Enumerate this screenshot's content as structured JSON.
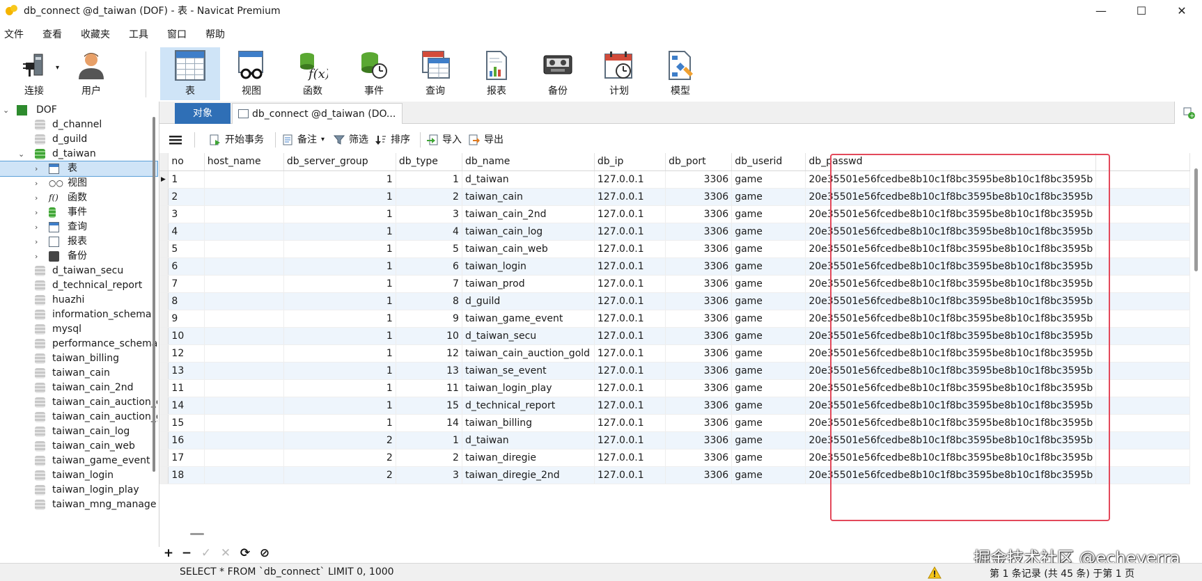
{
  "window": {
    "title": "db_connect @d_taiwan (DOF) - 表 - Navicat Premium",
    "controls": [
      "—",
      "☐",
      "✕"
    ]
  },
  "menu": [
    "文件",
    "查看",
    "收藏夹",
    "工具",
    "窗口",
    "帮助"
  ],
  "toolbar": {
    "connect": "连接",
    "user": "用户",
    "table": "表",
    "view": "视图",
    "function": "函数",
    "event": "事件",
    "query": "查询",
    "report": "报表",
    "backup": "备份",
    "schedule": "计划",
    "model": "模型"
  },
  "tree": {
    "root": "DOF",
    "d_channel": "d_channel",
    "d_guild": "d_guild",
    "d_taiwan": "d_taiwan",
    "sub_table": "表",
    "sub_view": "视图",
    "sub_function": "函数",
    "sub_event": "事件",
    "sub_query": "查询",
    "sub_report": "报表",
    "sub_backup": "备份",
    "others": [
      "d_taiwan_secu",
      "d_technical_report",
      "huazhi",
      "information_schema",
      "mysql",
      "performance_schema",
      "taiwan_billing",
      "taiwan_cain",
      "taiwan_cain_2nd",
      "taiwan_cain_auction_c",
      "taiwan_cain_auction_g",
      "taiwan_cain_log",
      "taiwan_cain_web",
      "taiwan_game_event",
      "taiwan_login",
      "taiwan_login_play",
      "taiwan_mng_manage"
    ]
  },
  "tabs": {
    "objects": "对象",
    "table_tab": "db_connect @d_taiwan (DO..."
  },
  "subtoolbar": {
    "begin_tx": "开始事务",
    "note": "备注",
    "filter": "筛选",
    "sort": "排序",
    "import": "导入",
    "export": "导出"
  },
  "grid": {
    "columns": [
      "no",
      "host_name",
      "db_server_group",
      "db_type",
      "db_name",
      "db_ip",
      "db_port",
      "db_userid",
      "db_passwd"
    ],
    "rows": [
      [
        "1",
        "",
        "1",
        "1",
        "d_taiwan",
        "127.0.0.1",
        "3306",
        "game",
        "20e35501e56fcedbe8b10c1f8bc3595be8b10c1f8bc3595b"
      ],
      [
        "2",
        "",
        "1",
        "2",
        "taiwan_cain",
        "127.0.0.1",
        "3306",
        "game",
        "20e35501e56fcedbe8b10c1f8bc3595be8b10c1f8bc3595b"
      ],
      [
        "3",
        "",
        "1",
        "3",
        "taiwan_cain_2nd",
        "127.0.0.1",
        "3306",
        "game",
        "20e35501e56fcedbe8b10c1f8bc3595be8b10c1f8bc3595b"
      ],
      [
        "4",
        "",
        "1",
        "4",
        "taiwan_cain_log",
        "127.0.0.1",
        "3306",
        "game",
        "20e35501e56fcedbe8b10c1f8bc3595be8b10c1f8bc3595b"
      ],
      [
        "5",
        "",
        "1",
        "5",
        "taiwan_cain_web",
        "127.0.0.1",
        "3306",
        "game",
        "20e35501e56fcedbe8b10c1f8bc3595be8b10c1f8bc3595b"
      ],
      [
        "6",
        "",
        "1",
        "6",
        "taiwan_login",
        "127.0.0.1",
        "3306",
        "game",
        "20e35501e56fcedbe8b10c1f8bc3595be8b10c1f8bc3595b"
      ],
      [
        "7",
        "",
        "1",
        "7",
        "taiwan_prod",
        "127.0.0.1",
        "3306",
        "game",
        "20e35501e56fcedbe8b10c1f8bc3595be8b10c1f8bc3595b"
      ],
      [
        "8",
        "",
        "1",
        "8",
        "d_guild",
        "127.0.0.1",
        "3306",
        "game",
        "20e35501e56fcedbe8b10c1f8bc3595be8b10c1f8bc3595b"
      ],
      [
        "9",
        "",
        "1",
        "9",
        "taiwan_game_event",
        "127.0.0.1",
        "3306",
        "game",
        "20e35501e56fcedbe8b10c1f8bc3595be8b10c1f8bc3595b"
      ],
      [
        "10",
        "",
        "1",
        "10",
        "d_taiwan_secu",
        "127.0.0.1",
        "3306",
        "game",
        "20e35501e56fcedbe8b10c1f8bc3595be8b10c1f8bc3595b"
      ],
      [
        "12",
        "",
        "1",
        "12",
        "taiwan_cain_auction_gold",
        "127.0.0.1",
        "3306",
        "game",
        "20e35501e56fcedbe8b10c1f8bc3595be8b10c1f8bc3595b"
      ],
      [
        "13",
        "",
        "1",
        "13",
        "taiwan_se_event",
        "127.0.0.1",
        "3306",
        "game",
        "20e35501e56fcedbe8b10c1f8bc3595be8b10c1f8bc3595b"
      ],
      [
        "11",
        "",
        "1",
        "11",
        "taiwan_login_play",
        "127.0.0.1",
        "3306",
        "game",
        "20e35501e56fcedbe8b10c1f8bc3595be8b10c1f8bc3595b"
      ],
      [
        "14",
        "",
        "1",
        "15",
        "d_technical_report",
        "127.0.0.1",
        "3306",
        "game",
        "20e35501e56fcedbe8b10c1f8bc3595be8b10c1f8bc3595b"
      ],
      [
        "15",
        "",
        "1",
        "14",
        "taiwan_billing",
        "127.0.0.1",
        "3306",
        "game",
        "20e35501e56fcedbe8b10c1f8bc3595be8b10c1f8bc3595b"
      ],
      [
        "16",
        "",
        "2",
        "1",
        "d_taiwan",
        "127.0.0.1",
        "3306",
        "game",
        "20e35501e56fcedbe8b10c1f8bc3595be8b10c1f8bc3595b"
      ],
      [
        "17",
        "",
        "2",
        "2",
        "taiwan_diregie",
        "127.0.0.1",
        "3306",
        "game",
        "20e35501e56fcedbe8b10c1f8bc3595be8b10c1f8bc3595b"
      ],
      [
        "18",
        "",
        "2",
        "3",
        "taiwan_diregie_2nd",
        "127.0.0.1",
        "3306",
        "game",
        "20e35501e56fcedbe8b10c1f8bc3595be8b10c1f8bc3595b"
      ]
    ]
  },
  "navbar": {
    "add": "+",
    "delete": "−",
    "apply": "✓",
    "discard": "✕",
    "refresh": "⟳",
    "stop": "⊘"
  },
  "watermark": "掘金技术社区 @echeverra",
  "status": {
    "sql": "SELECT * FROM `db_connect` LIMIT 0, 1000",
    "records": "第 1 条记录 (共 45 条) 于第 1 页"
  },
  "colors": {
    "accent": "#2f6fb6",
    "selection": "#cfe4f7",
    "highlight_border": "#e3485a",
    "alt_row": "#eef5fc"
  }
}
